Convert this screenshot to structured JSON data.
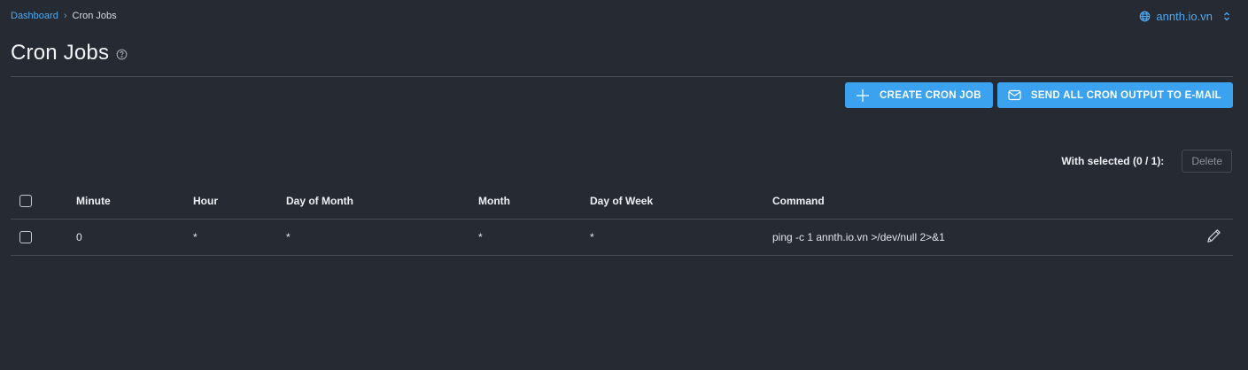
{
  "breadcrumb": {
    "dashboard": "Dashboard",
    "separator": "›",
    "current": "Cron Jobs"
  },
  "domain_selector": {
    "icon": "globe-icon",
    "value": "annth.io.vn",
    "toggle_icon": "chevron-up-down-icon"
  },
  "page": {
    "title": "Cron Jobs",
    "help_icon": "help-circle-icon"
  },
  "actions": {
    "create_label": "CREATE CRON JOB",
    "create_icon": "plus-icon",
    "email_label": "SEND ALL CRON OUTPUT TO E-MAIL",
    "email_icon": "envelope-icon"
  },
  "bulk": {
    "label": "With selected (0 / 1):",
    "delete_label": "Delete"
  },
  "table": {
    "columns": [
      "Minute",
      "Hour",
      "Day of Month",
      "Month",
      "Day of Week",
      "Command"
    ],
    "rows": [
      {
        "minute": "0",
        "hour": "*",
        "day_of_month": "*",
        "month": "*",
        "day_of_week": "*",
        "command": "ping -c 1 annth.io.vn >/dev/null 2>&1",
        "edit_icon": "pencil-icon"
      }
    ]
  },
  "colors": {
    "background": "#262a33",
    "accent": "#3aa2ee",
    "link": "#4fa8ee",
    "divider": "#454a54"
  }
}
